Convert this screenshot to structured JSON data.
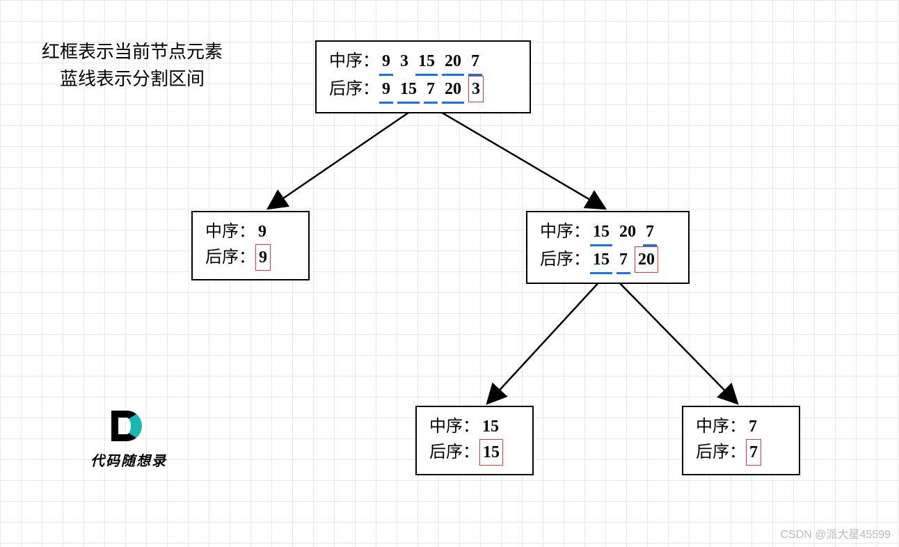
{
  "legend": {
    "line1": "红框表示当前节点元素",
    "line2": "蓝线表示分割区间"
  },
  "labels": {
    "inorder": "中序：",
    "postorder": "后序："
  },
  "nodes": {
    "root": {
      "inorder": [
        "9",
        "3",
        "15",
        "20",
        "7"
      ],
      "postorder": [
        "9",
        "15",
        "7",
        "20",
        "3"
      ],
      "in_underline_groups": [
        [
          0,
          0
        ],
        [
          2,
          4
        ]
      ],
      "post_underline_groups": [
        [
          0,
          0
        ],
        [
          1,
          3
        ]
      ],
      "post_redbox_index": 4
    },
    "left": {
      "inorder": [
        "9"
      ],
      "postorder": [
        "9"
      ],
      "in_underline_groups": [],
      "post_underline_groups": [],
      "post_redbox_index": 0
    },
    "right": {
      "inorder": [
        "15",
        "20",
        "7"
      ],
      "postorder": [
        "15",
        "7",
        "20"
      ],
      "in_underline_groups": [
        [
          0,
          0
        ],
        [
          2,
          2
        ]
      ],
      "post_underline_groups": [
        [
          0,
          0
        ],
        [
          1,
          1
        ]
      ],
      "post_redbox_index": 2
    },
    "rl": {
      "inorder": [
        "15"
      ],
      "postorder": [
        "15"
      ],
      "in_underline_groups": [],
      "post_underline_groups": [],
      "post_redbox_index": 0
    },
    "rr": {
      "inorder": [
        "7"
      ],
      "postorder": [
        "7"
      ],
      "in_underline_groups": [],
      "post_underline_groups": [],
      "post_redbox_index": 0
    }
  },
  "logo_text": "代码随想录",
  "watermark": "CSDN @派大星45599"
}
